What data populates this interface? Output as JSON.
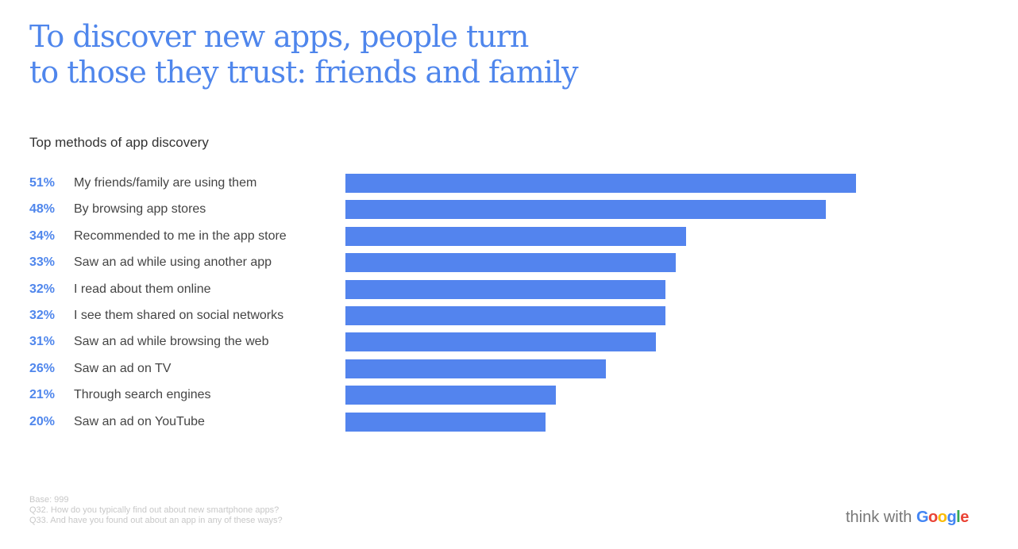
{
  "title_lines": [
    "To discover new apps, people turn",
    "to those they trust: friends and family"
  ],
  "brand": {
    "prefix": "think with ",
    "google_letters": [
      {
        "ch": "G",
        "color": "#4285f4"
      },
      {
        "ch": "o",
        "color": "#ea4335"
      },
      {
        "ch": "o",
        "color": "#fbbc05"
      },
      {
        "ch": "g",
        "color": "#4285f4"
      },
      {
        "ch": "l",
        "color": "#34a853"
      },
      {
        "ch": "e",
        "color": "#ea4335"
      }
    ]
  },
  "footnote": [
    "Base: 999",
    "Q32. How do you typically find out about new smartphone apps?",
    "Q33. And have you found out about an app in any of these ways?"
  ],
  "colors": {
    "accent": "#4f86ec",
    "bar": "#5384ee"
  },
  "chart_data": {
    "type": "bar",
    "orientation": "horizontal",
    "title": "Top methods of app discovery",
    "xlabel": "",
    "ylabel": "",
    "xlim": [
      0,
      51
    ],
    "grid": false,
    "legend": "none",
    "unit": "%",
    "categories": [
      "My friends/family are using them",
      "By browsing app stores",
      "Recommended to me in the app store",
      "Saw an ad while using another app",
      "I read about them online",
      "I see them shared on social networks",
      "Saw an ad while browsing the web",
      "Saw an ad on TV",
      "Through search engines",
      "Saw an ad on YouTube"
    ],
    "values": [
      51,
      48,
      34,
      33,
      32,
      32,
      31,
      26,
      21,
      20
    ],
    "value_labels": [
      "51%",
      "48%",
      "34%",
      "33%",
      "32%",
      "32%",
      "31%",
      "26%",
      "21%",
      "20%"
    ]
  }
}
